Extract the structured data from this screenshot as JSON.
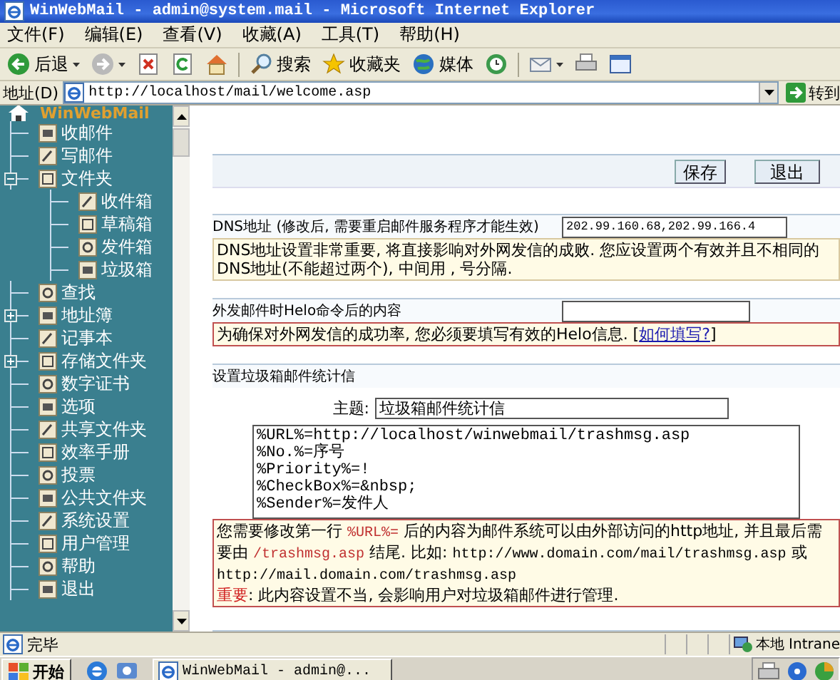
{
  "window": {
    "title": "WinWebMail - admin@system.mail - Microsoft Internet Explorer"
  },
  "menu": [
    "文件(F)",
    "编辑(E)",
    "查看(V)",
    "收藏(A)",
    "工具(T)",
    "帮助(H)"
  ],
  "toolbar": [
    {
      "kind": "back",
      "label": "后退"
    },
    {
      "kind": "forward"
    },
    {
      "kind": "stop"
    },
    {
      "kind": "refresh"
    },
    {
      "kind": "home"
    },
    {
      "kind": "search",
      "label": "搜索"
    },
    {
      "kind": "favorites",
      "label": "收藏夹"
    },
    {
      "kind": "media",
      "label": "媒体"
    },
    {
      "kind": "history"
    },
    {
      "kind": "mail"
    },
    {
      "kind": "print"
    },
    {
      "kind": "edit"
    }
  ],
  "address": {
    "label": "地址(D)",
    "url": "http://localhost/mail/welcome.asp",
    "go": "转到"
  },
  "sidebar": {
    "root": "WinWebMail",
    "items": [
      {
        "label": "收邮件"
      },
      {
        "label": "写邮件"
      },
      {
        "label": "文件夹",
        "expanded": true,
        "children": [
          {
            "label": "收件箱"
          },
          {
            "label": "草稿箱"
          },
          {
            "label": "发件箱"
          },
          {
            "label": "垃圾箱"
          }
        ]
      },
      {
        "label": "查找"
      },
      {
        "label": "地址簿",
        "expanded": false
      },
      {
        "label": "记事本"
      },
      {
        "label": "存储文件夹",
        "expanded": false
      },
      {
        "label": "数字证书"
      },
      {
        "label": "选项"
      },
      {
        "label": "共享文件夹"
      },
      {
        "label": "效率手册"
      },
      {
        "label": "投票"
      },
      {
        "label": "公共文件夹"
      },
      {
        "label": "系统设置"
      },
      {
        "label": "用户管理"
      },
      {
        "label": "帮助"
      },
      {
        "label": "退出"
      }
    ]
  },
  "actions": [
    "保存",
    "退出"
  ],
  "dns": {
    "label": "DNS地址 (修改后, 需要重启邮件服务程序才能生效)",
    "value": "202.99.160.68,202.99.166.4",
    "note": [
      {
        "text": "DNS地址设置非常重要, 将直接影响对外网发信的成败. 您应设置两个有效并且不相同的DNS地址(不能超过两个), 中间用 , 号分隔."
      }
    ]
  },
  "helo": {
    "label": "外发邮件时Helo命令后的内容",
    "note": [
      {
        "text": "为确保对外网发信的成功率, 您必须要填写有效的Helo信息.     ["
      },
      {
        "kind": "link",
        "text": "如何填写?"
      },
      {
        "text": "]"
      }
    ]
  },
  "trash": {
    "title": "设置垃圾箱邮件统计信",
    "subject_label": "主题:",
    "subject_value": "垃圾箱邮件统计信",
    "template": [
      "%URL%=http://localhost/winwebmail/trashmsg.asp",
      "%No.%=序号",
      "%Priority%=!",
      "%CheckBox%=&nbsp;",
      "%Sender%=发件人"
    ],
    "note": [
      [
        {
          "text": "您需要修改第一行 "
        },
        {
          "kind": "code",
          "text": "%URL%="
        },
        {
          "text": " 后的内容为邮件系统可以由外部访问的http地址, 并且最后需要由 "
        },
        {
          "kind": "code",
          "text": "/trashmsg.asp"
        },
        {
          "text": " 结尾. 比如: "
        },
        {
          "kind": "mono",
          "text": "http://www.domain.com/mail/trashmsg.asp"
        },
        {
          "text": " 或 "
        },
        {
          "kind": "mono",
          "text": "http://mail.domain.com/trashmsg.asp"
        }
      ],
      [
        {
          "kind": "alert",
          "text": "重要"
        },
        {
          "text": ": 此内容设置不当, 会影响用户对垃圾箱邮件进行管理."
        }
      ]
    ]
  },
  "status_bar": {
    "text": "完毕",
    "zone": "本地 Intrane"
  },
  "taskbar": {
    "start": "开始",
    "tasks": [
      "WinWebMail - admin@..."
    ]
  }
}
